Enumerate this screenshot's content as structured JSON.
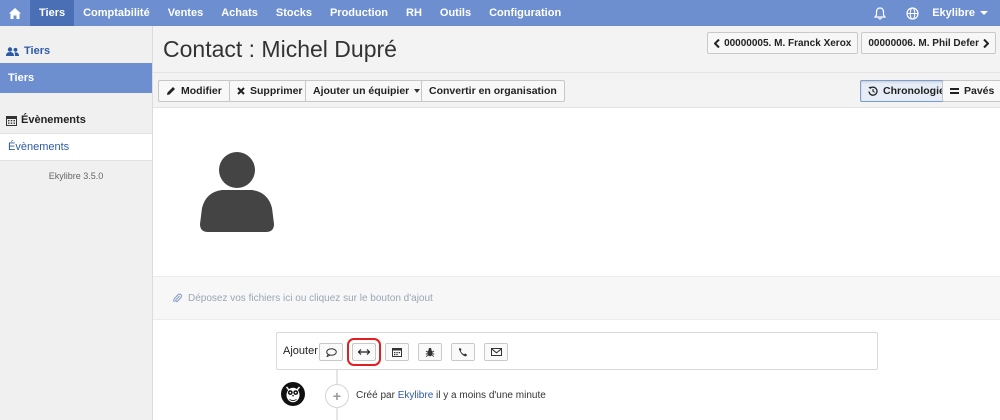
{
  "topnav": {
    "items": [
      "Tiers",
      "Comptabilité",
      "Ventes",
      "Achats",
      "Stocks",
      "Production",
      "RH",
      "Outils",
      "Configuration"
    ],
    "active": "Tiers",
    "user": "Ekylibre",
    "color": "#6d8fcf"
  },
  "sidebar": {
    "section1": "Tiers",
    "active_item": "Tiers",
    "section2": "Évènements",
    "link": "Évènements",
    "version": "Ekylibre 3.5.0"
  },
  "header": {
    "title": "Contact : Michel Dupré",
    "prev": "00000005. M. Franck Xerox",
    "next": "00000006. M. Phil Defer"
  },
  "toolbar": {
    "modifier": "Modifier",
    "supprimer": "Supprimer",
    "ajouter_equipier": "Ajouter un équipier",
    "convertir": "Convertir en organisation",
    "chronologie": "Chronologie",
    "paves": "Pavés"
  },
  "dropzone": {
    "text": "Déposez vos fichiers ici ou cliquez sur le bouton d'ajout"
  },
  "timeline": {
    "add_label": "Ajouter",
    "icons": [
      "comment-icon",
      "link-icon",
      "calendar-icon",
      "bug-icon",
      "phone-icon",
      "email-icon"
    ],
    "created_prefix": "Créé par",
    "created_user": "Ekylibre",
    "created_suffix": "il y a moins d'une minute"
  }
}
